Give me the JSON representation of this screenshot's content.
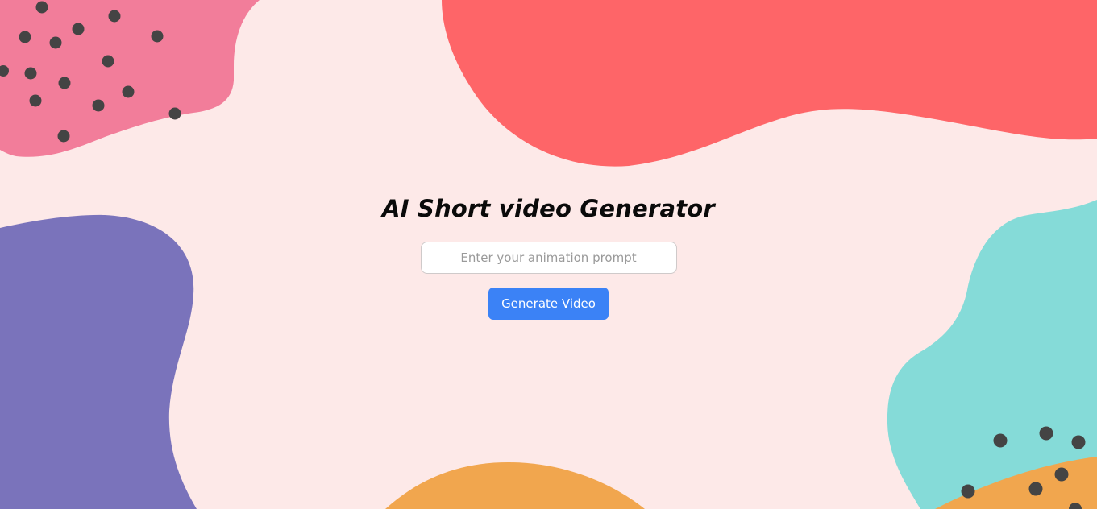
{
  "page": {
    "title": "AI Short video Generator",
    "prompt_placeholder": "Enter your animation prompt",
    "generate_label": "Generate Video"
  },
  "colors": {
    "background": "#fde9e8",
    "pink_blob": "#f27d9a",
    "red_blob": "#fe6568",
    "purple_blob": "#7a73bb",
    "teal_blob": "#85dbd8",
    "orange_blob": "#f1a64e",
    "dots": "#444444",
    "button": "#3b82f6"
  }
}
